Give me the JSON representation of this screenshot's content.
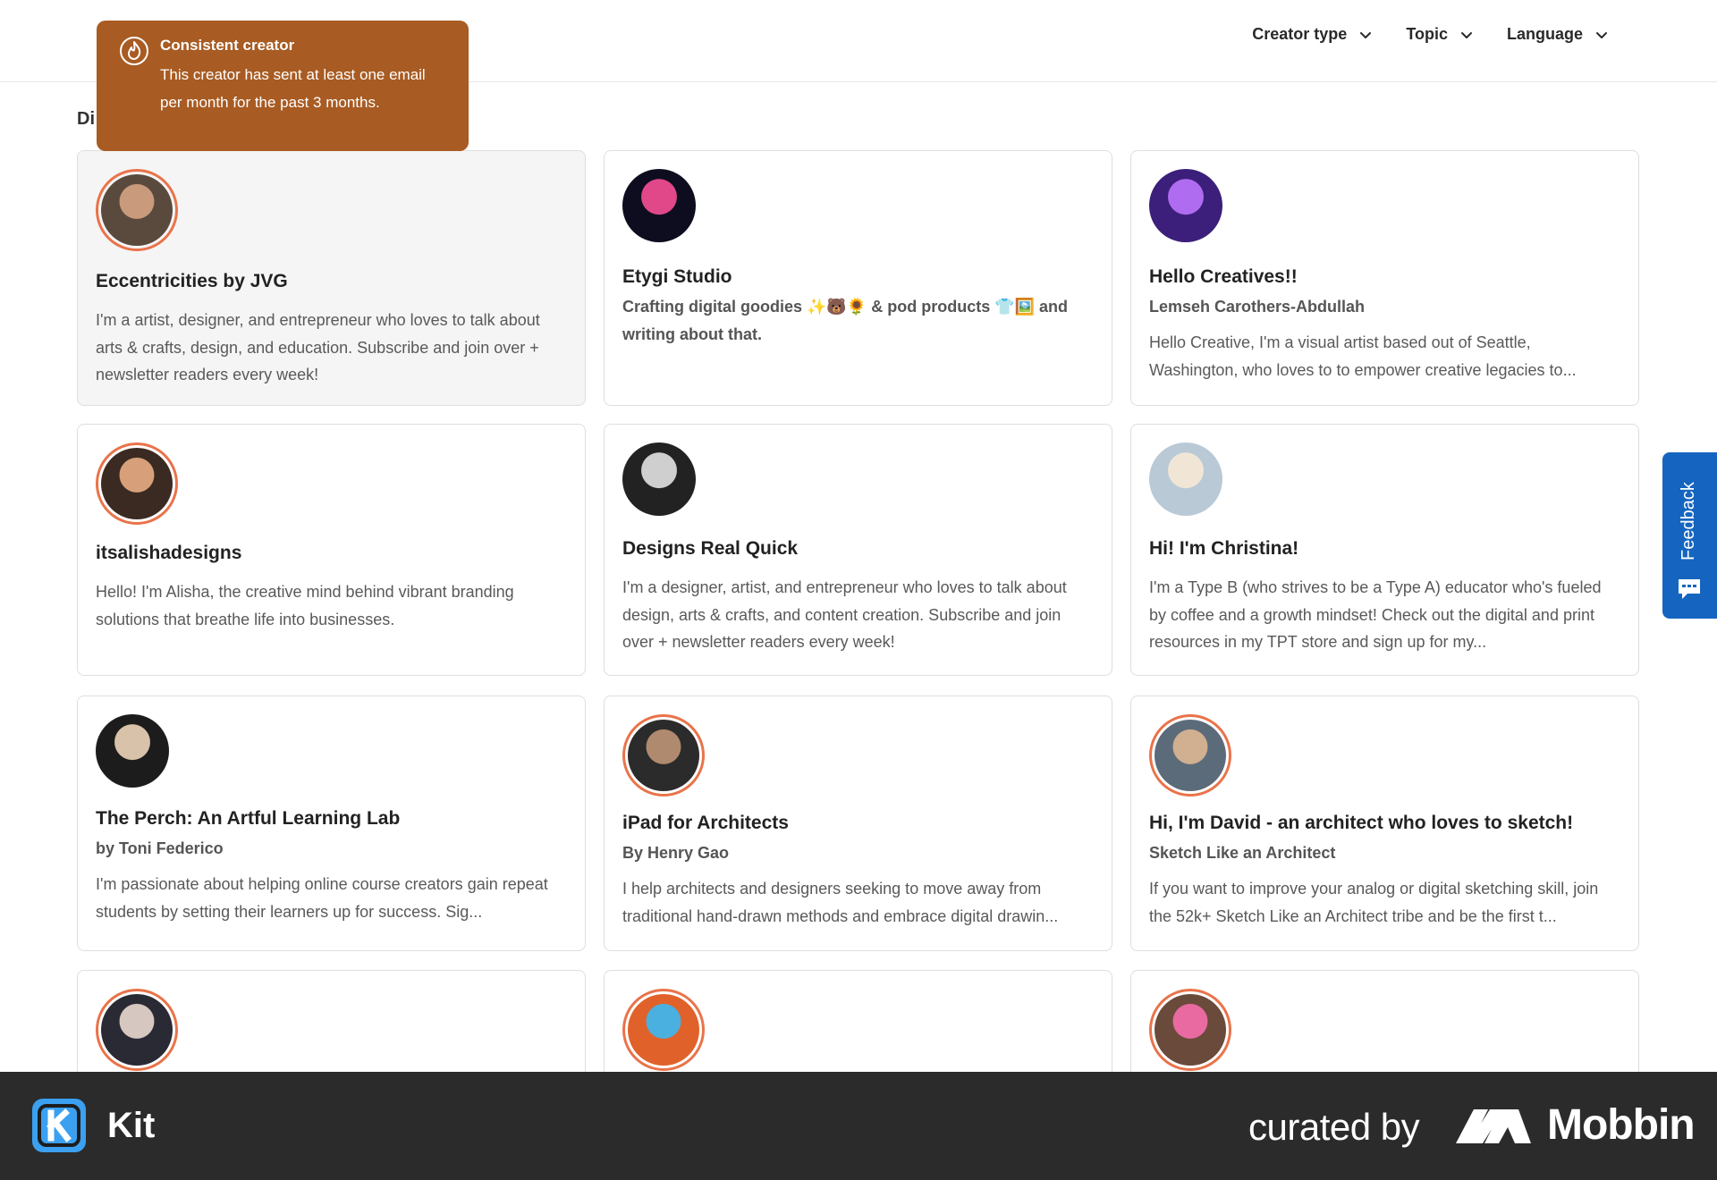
{
  "filters": [
    {
      "label": "Creator type"
    },
    {
      "label": "Topic"
    },
    {
      "label": "Language"
    }
  ],
  "section_title": "Di",
  "tooltip": {
    "title": "Consistent creator",
    "body": "This creator has sent at least one email per month for the past 3 months."
  },
  "cards": [
    {
      "name": "Eccentricities by JVG",
      "subtitle": "",
      "description": "I'm a artist, designer, and entrepreneur who loves to talk about arts & crafts, design, and education. Subscribe and join over + newsletter readers every week!",
      "consistent": true,
      "avatar_colors": [
        "#5a4a3e",
        "#c99a7c"
      ]
    },
    {
      "name": "Etygi Studio",
      "subtitle": "Crafting digital goodies ✨🐻🌻 & pod products 👕🖼️ and writing about that.",
      "description": "",
      "consistent": false,
      "avatar_colors": [
        "#0d0d1f",
        "#e0488a"
      ]
    },
    {
      "name": "Hello Creatives!!",
      "subtitle": "Lemseh Carothers-Abdullah",
      "description": "Hello Creative, I'm a visual artist based out of Seattle, Washington, who loves to to empower creative legacies to...",
      "consistent": false,
      "avatar_colors": [
        "#3b1f7a",
        "#b06cf0"
      ]
    },
    {
      "name": "itsalishadesigns",
      "subtitle": "",
      "description": "Hello! I'm Alisha, the creative mind behind vibrant branding solutions that breathe life into businesses.",
      "consistent": true,
      "avatar_colors": [
        "#3a2a22",
        "#d8a07a"
      ]
    },
    {
      "name": "Designs Real Quick",
      "subtitle": "",
      "description": "I'm a designer, artist, and entrepreneur who loves to talk about design, arts & crafts, and content creation. Subscribe and join over + newsletter readers every week!",
      "consistent": false,
      "avatar_colors": [
        "#222222",
        "#cfcfcf"
      ]
    },
    {
      "name": "Hi! I'm Christina!",
      "subtitle": "",
      "description": "I'm a Type B (who strives to be a Type A) educator who's fueled by coffee and a growth mindset! Check out the digital and print resources in my TPT store and sign up for my...",
      "consistent": false,
      "avatar_colors": [
        "#b9c9d6",
        "#f1e6d6"
      ]
    },
    {
      "name": "The Perch: An Artful Learning Lab",
      "subtitle": "by Toni Federico",
      "description": "I'm passionate about helping online course creators gain repeat students by setting their learners up for success. Sig...",
      "consistent": false,
      "avatar_colors": [
        "#1c1c1c",
        "#d9c2aa"
      ]
    },
    {
      "name": "iPad for Architects",
      "subtitle": "By Henry Gao",
      "description": "I help architects and designers seeking to move away from traditional hand-drawn methods and embrace digital drawin...",
      "consistent": true,
      "avatar_colors": [
        "#2b2b2b",
        "#b08a6e"
      ]
    },
    {
      "name": "Hi, I'm David - an architect who loves to sketch!",
      "subtitle": "Sketch Like an Architect",
      "description": "If you want to improve your analog or digital sketching skill, join the 52k+ Sketch Like an Architect tribe and be the first t...",
      "consistent": true,
      "avatar_colors": [
        "#5b6b7a",
        "#d0b090"
      ]
    },
    {
      "name": "",
      "subtitle": "",
      "description": "",
      "consistent": true,
      "avatar_colors": [
        "#2a2a35",
        "#d6c8c0"
      ]
    },
    {
      "name": "",
      "subtitle": "",
      "description": "",
      "consistent": true,
      "avatar_colors": [
        "#e0622a",
        "#4ab0e0"
      ]
    },
    {
      "name": "",
      "subtitle": "",
      "description": "",
      "consistent": true,
      "avatar_colors": [
        "#6a4a3a",
        "#e86aa0"
      ]
    }
  ],
  "feedback": {
    "label": "Feedback"
  },
  "footer": {
    "brand": "Kit",
    "curated_by": "curated by",
    "curator": "Mobbin"
  },
  "colors": {
    "tooltip_bg": "#a85b22",
    "ring": "#e9734a",
    "feedback_bg": "#1565c0",
    "footer_bg": "#2b2b2b",
    "kit_blue": "#3ba0f0"
  }
}
